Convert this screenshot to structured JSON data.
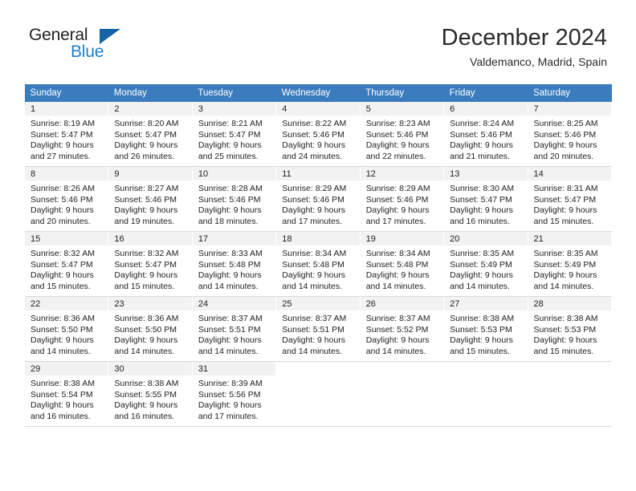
{
  "brand": {
    "name_part1": "General",
    "name_part2": "Blue",
    "triangle_color": "#1464a5",
    "blue_color": "#1f7fc4"
  },
  "header": {
    "month_title": "December 2024",
    "location": "Valdemanco, Madrid, Spain"
  },
  "calendar": {
    "header_bg": "#3a7cbe",
    "daynum_bg": "#f2f2f2",
    "weekdays": [
      "Sunday",
      "Monday",
      "Tuesday",
      "Wednesday",
      "Thursday",
      "Friday",
      "Saturday"
    ],
    "weeks": [
      [
        {
          "day": "1",
          "sunrise": "Sunrise: 8:19 AM",
          "sunset": "Sunset: 5:47 PM",
          "daylight1": "Daylight: 9 hours",
          "daylight2": "and 27 minutes."
        },
        {
          "day": "2",
          "sunrise": "Sunrise: 8:20 AM",
          "sunset": "Sunset: 5:47 PM",
          "daylight1": "Daylight: 9 hours",
          "daylight2": "and 26 minutes."
        },
        {
          "day": "3",
          "sunrise": "Sunrise: 8:21 AM",
          "sunset": "Sunset: 5:47 PM",
          "daylight1": "Daylight: 9 hours",
          "daylight2": "and 25 minutes."
        },
        {
          "day": "4",
          "sunrise": "Sunrise: 8:22 AM",
          "sunset": "Sunset: 5:46 PM",
          "daylight1": "Daylight: 9 hours",
          "daylight2": "and 24 minutes."
        },
        {
          "day": "5",
          "sunrise": "Sunrise: 8:23 AM",
          "sunset": "Sunset: 5:46 PM",
          "daylight1": "Daylight: 9 hours",
          "daylight2": "and 22 minutes."
        },
        {
          "day": "6",
          "sunrise": "Sunrise: 8:24 AM",
          "sunset": "Sunset: 5:46 PM",
          "daylight1": "Daylight: 9 hours",
          "daylight2": "and 21 minutes."
        },
        {
          "day": "7",
          "sunrise": "Sunrise: 8:25 AM",
          "sunset": "Sunset: 5:46 PM",
          "daylight1": "Daylight: 9 hours",
          "daylight2": "and 20 minutes."
        }
      ],
      [
        {
          "day": "8",
          "sunrise": "Sunrise: 8:26 AM",
          "sunset": "Sunset: 5:46 PM",
          "daylight1": "Daylight: 9 hours",
          "daylight2": "and 20 minutes."
        },
        {
          "day": "9",
          "sunrise": "Sunrise: 8:27 AM",
          "sunset": "Sunset: 5:46 PM",
          "daylight1": "Daylight: 9 hours",
          "daylight2": "and 19 minutes."
        },
        {
          "day": "10",
          "sunrise": "Sunrise: 8:28 AM",
          "sunset": "Sunset: 5:46 PM",
          "daylight1": "Daylight: 9 hours",
          "daylight2": "and 18 minutes."
        },
        {
          "day": "11",
          "sunrise": "Sunrise: 8:29 AM",
          "sunset": "Sunset: 5:46 PM",
          "daylight1": "Daylight: 9 hours",
          "daylight2": "and 17 minutes."
        },
        {
          "day": "12",
          "sunrise": "Sunrise: 8:29 AM",
          "sunset": "Sunset: 5:46 PM",
          "daylight1": "Daylight: 9 hours",
          "daylight2": "and 17 minutes."
        },
        {
          "day": "13",
          "sunrise": "Sunrise: 8:30 AM",
          "sunset": "Sunset: 5:47 PM",
          "daylight1": "Daylight: 9 hours",
          "daylight2": "and 16 minutes."
        },
        {
          "day": "14",
          "sunrise": "Sunrise: 8:31 AM",
          "sunset": "Sunset: 5:47 PM",
          "daylight1": "Daylight: 9 hours",
          "daylight2": "and 15 minutes."
        }
      ],
      [
        {
          "day": "15",
          "sunrise": "Sunrise: 8:32 AM",
          "sunset": "Sunset: 5:47 PM",
          "daylight1": "Daylight: 9 hours",
          "daylight2": "and 15 minutes."
        },
        {
          "day": "16",
          "sunrise": "Sunrise: 8:32 AM",
          "sunset": "Sunset: 5:47 PM",
          "daylight1": "Daylight: 9 hours",
          "daylight2": "and 15 minutes."
        },
        {
          "day": "17",
          "sunrise": "Sunrise: 8:33 AM",
          "sunset": "Sunset: 5:48 PM",
          "daylight1": "Daylight: 9 hours",
          "daylight2": "and 14 minutes."
        },
        {
          "day": "18",
          "sunrise": "Sunrise: 8:34 AM",
          "sunset": "Sunset: 5:48 PM",
          "daylight1": "Daylight: 9 hours",
          "daylight2": "and 14 minutes."
        },
        {
          "day": "19",
          "sunrise": "Sunrise: 8:34 AM",
          "sunset": "Sunset: 5:48 PM",
          "daylight1": "Daylight: 9 hours",
          "daylight2": "and 14 minutes."
        },
        {
          "day": "20",
          "sunrise": "Sunrise: 8:35 AM",
          "sunset": "Sunset: 5:49 PM",
          "daylight1": "Daylight: 9 hours",
          "daylight2": "and 14 minutes."
        },
        {
          "day": "21",
          "sunrise": "Sunrise: 8:35 AM",
          "sunset": "Sunset: 5:49 PM",
          "daylight1": "Daylight: 9 hours",
          "daylight2": "and 14 minutes."
        }
      ],
      [
        {
          "day": "22",
          "sunrise": "Sunrise: 8:36 AM",
          "sunset": "Sunset: 5:50 PM",
          "daylight1": "Daylight: 9 hours",
          "daylight2": "and 14 minutes."
        },
        {
          "day": "23",
          "sunrise": "Sunrise: 8:36 AM",
          "sunset": "Sunset: 5:50 PM",
          "daylight1": "Daylight: 9 hours",
          "daylight2": "and 14 minutes."
        },
        {
          "day": "24",
          "sunrise": "Sunrise: 8:37 AM",
          "sunset": "Sunset: 5:51 PM",
          "daylight1": "Daylight: 9 hours",
          "daylight2": "and 14 minutes."
        },
        {
          "day": "25",
          "sunrise": "Sunrise: 8:37 AM",
          "sunset": "Sunset: 5:51 PM",
          "daylight1": "Daylight: 9 hours",
          "daylight2": "and 14 minutes."
        },
        {
          "day": "26",
          "sunrise": "Sunrise: 8:37 AM",
          "sunset": "Sunset: 5:52 PM",
          "daylight1": "Daylight: 9 hours",
          "daylight2": "and 14 minutes."
        },
        {
          "day": "27",
          "sunrise": "Sunrise: 8:38 AM",
          "sunset": "Sunset: 5:53 PM",
          "daylight1": "Daylight: 9 hours",
          "daylight2": "and 15 minutes."
        },
        {
          "day": "28",
          "sunrise": "Sunrise: 8:38 AM",
          "sunset": "Sunset: 5:53 PM",
          "daylight1": "Daylight: 9 hours",
          "daylight2": "and 15 minutes."
        }
      ],
      [
        {
          "day": "29",
          "sunrise": "Sunrise: 8:38 AM",
          "sunset": "Sunset: 5:54 PM",
          "daylight1": "Daylight: 9 hours",
          "daylight2": "and 16 minutes."
        },
        {
          "day": "30",
          "sunrise": "Sunrise: 8:38 AM",
          "sunset": "Sunset: 5:55 PM",
          "daylight1": "Daylight: 9 hours",
          "daylight2": "and 16 minutes."
        },
        {
          "day": "31",
          "sunrise": "Sunrise: 8:39 AM",
          "sunset": "Sunset: 5:56 PM",
          "daylight1": "Daylight: 9 hours",
          "daylight2": "and 17 minutes."
        },
        {
          "day": "",
          "sunrise": "",
          "sunset": "",
          "daylight1": "",
          "daylight2": ""
        },
        {
          "day": "",
          "sunrise": "",
          "sunset": "",
          "daylight1": "",
          "daylight2": ""
        },
        {
          "day": "",
          "sunrise": "",
          "sunset": "",
          "daylight1": "",
          "daylight2": ""
        },
        {
          "day": "",
          "sunrise": "",
          "sunset": "",
          "daylight1": "",
          "daylight2": ""
        }
      ]
    ]
  }
}
